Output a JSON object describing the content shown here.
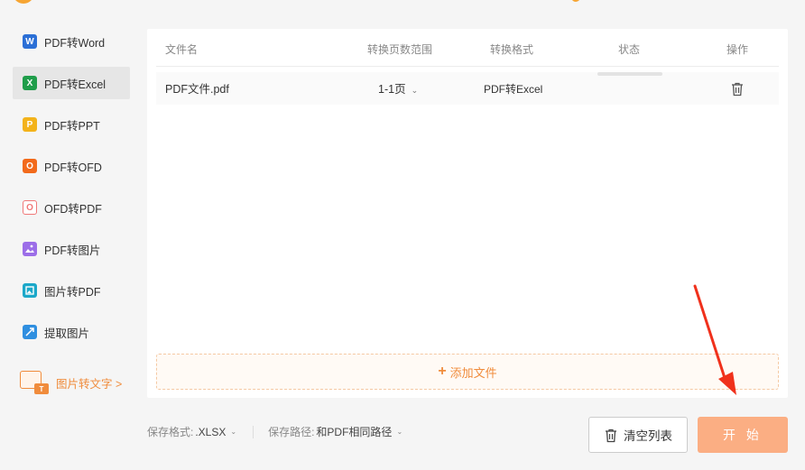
{
  "sidebar": {
    "items": [
      {
        "label": "PDF转Word",
        "icon": "word-icon",
        "glyph": "W",
        "active": false
      },
      {
        "label": "PDF转Excel",
        "icon": "excel-icon",
        "glyph": "X",
        "active": true
      },
      {
        "label": "PDF转PPT",
        "icon": "ppt-icon",
        "glyph": "P",
        "active": false
      },
      {
        "label": "PDF转OFD",
        "icon": "ofd-icon",
        "glyph": "O",
        "active": false
      },
      {
        "label": "OFD转PDF",
        "icon": "ofd-to-pdf-icon",
        "glyph": "O",
        "active": false
      },
      {
        "label": "PDF转图片",
        "icon": "pdf-to-image-icon",
        "glyph": "",
        "active": false
      },
      {
        "label": "图片转PDF",
        "icon": "image-to-pdf-icon",
        "glyph": "",
        "active": false
      },
      {
        "label": "提取图片",
        "icon": "extract-image-icon",
        "glyph": "",
        "active": false
      }
    ],
    "promo_label": "图片转文字 >"
  },
  "table": {
    "headers": {
      "name": "文件名",
      "range": "转换页数范围",
      "format": "转换格式",
      "status": "状态",
      "action": "操作"
    },
    "rows": [
      {
        "name": "PDF文件.pdf",
        "range": "1-1页",
        "format": "PDF转Excel",
        "progress": 0
      }
    ]
  },
  "add_file_label": "添加文件",
  "bottom": {
    "format_label": "保存格式:",
    "format_value": ".XLSX",
    "path_label": "保存路径:",
    "path_value": "和PDF相同路径"
  },
  "buttons": {
    "clear": "清空列表",
    "start": "开 始"
  },
  "colors": {
    "accent": "#f08c3c",
    "start_button": "#fbae83",
    "arrow": "#f0311c"
  }
}
